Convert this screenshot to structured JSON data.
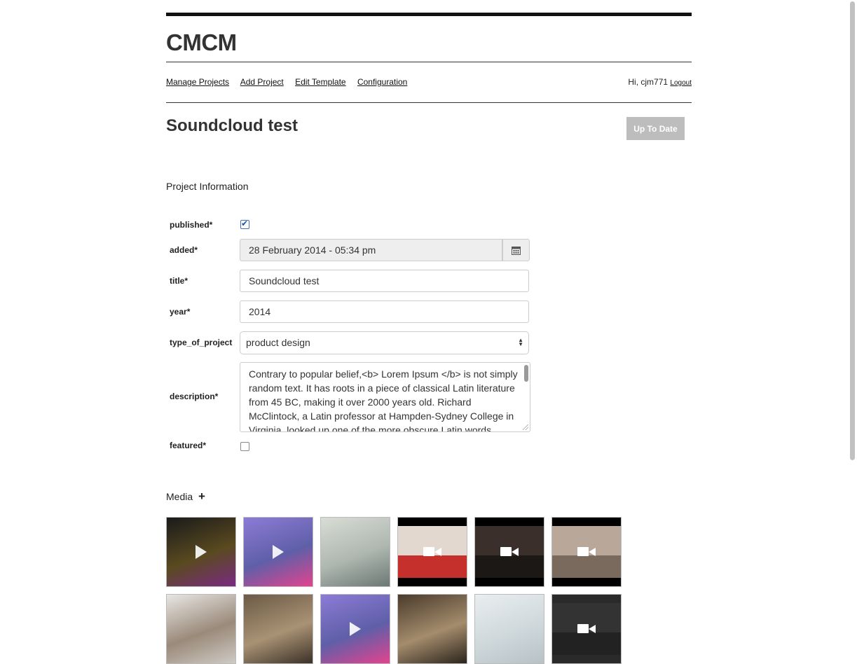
{
  "app": {
    "brand": "CMCM"
  },
  "nav": {
    "items": [
      "Manage Projects",
      "Add Project",
      "Edit Template",
      "Configuration"
    ],
    "greeting": "Hi, cjm771",
    "logout": "Logout"
  },
  "project": {
    "title": "Soundcloud test",
    "status_button": "Up To Date"
  },
  "sections": {
    "info": "Project Information",
    "media": "Media",
    "media_add": "+"
  },
  "form": {
    "published_label": "published*",
    "published": true,
    "added_label": "added*",
    "added_value": "28 February 2014 - 05:34 pm",
    "title_label": "title*",
    "title_value": "Soundcloud test",
    "year_label": "year*",
    "year_value": "2014",
    "type_label": "type_of_project",
    "type_value": "product design",
    "description_label": "description*",
    "description_value": "Contrary to popular belief,<b> Lorem Ipsum </b> is not simply random text. It has roots in a piece of classical Latin literature from 45 BC, making it over 2000 years old. Richard McClintock, a Latin professor at Hampden-Sydney College in Virginia, looked up one of the more obscure Latin words",
    "featured_label": "featured*",
    "featured": false
  },
  "media": [
    {
      "kind": "audio",
      "palette": [
        "#1a1a1a",
        "#5a4a20",
        "#7a2a80"
      ]
    },
    {
      "kind": "audio",
      "palette": [
        "#8c7bd6",
        "#5f5fa8",
        "#e3438f"
      ]
    },
    {
      "kind": "image",
      "palette": [
        "#d9ddd6",
        "#aeb7b0",
        "#6c7874"
      ]
    },
    {
      "kind": "video",
      "palette": [
        "#000000",
        "#e3d8cf",
        "#c5302c"
      ]
    },
    {
      "kind": "video",
      "palette": [
        "#000000",
        "#3a2f2a",
        "#1c1816"
      ]
    },
    {
      "kind": "video",
      "palette": [
        "#000000",
        "#b9a89a",
        "#7a6a5e"
      ]
    },
    {
      "kind": "image",
      "palette": [
        "#e8e6e3",
        "#9a8a7a",
        "#cfcac4"
      ]
    },
    {
      "kind": "image",
      "palette": [
        "#6b5a46",
        "#a99274",
        "#3b3128"
      ]
    },
    {
      "kind": "audio",
      "palette": [
        "#8c7bd6",
        "#5f5fa8",
        "#e3438f"
      ]
    },
    {
      "kind": "image",
      "palette": [
        "#4a3b2c",
        "#a48c6c",
        "#2b241c"
      ]
    },
    {
      "kind": "image",
      "palette": [
        "#e9eef0",
        "#cfd8db",
        "#b8c2c6"
      ]
    },
    {
      "kind": "video",
      "palette": [
        "#2a2a2a",
        "#333333",
        "#222222"
      ]
    }
  ]
}
